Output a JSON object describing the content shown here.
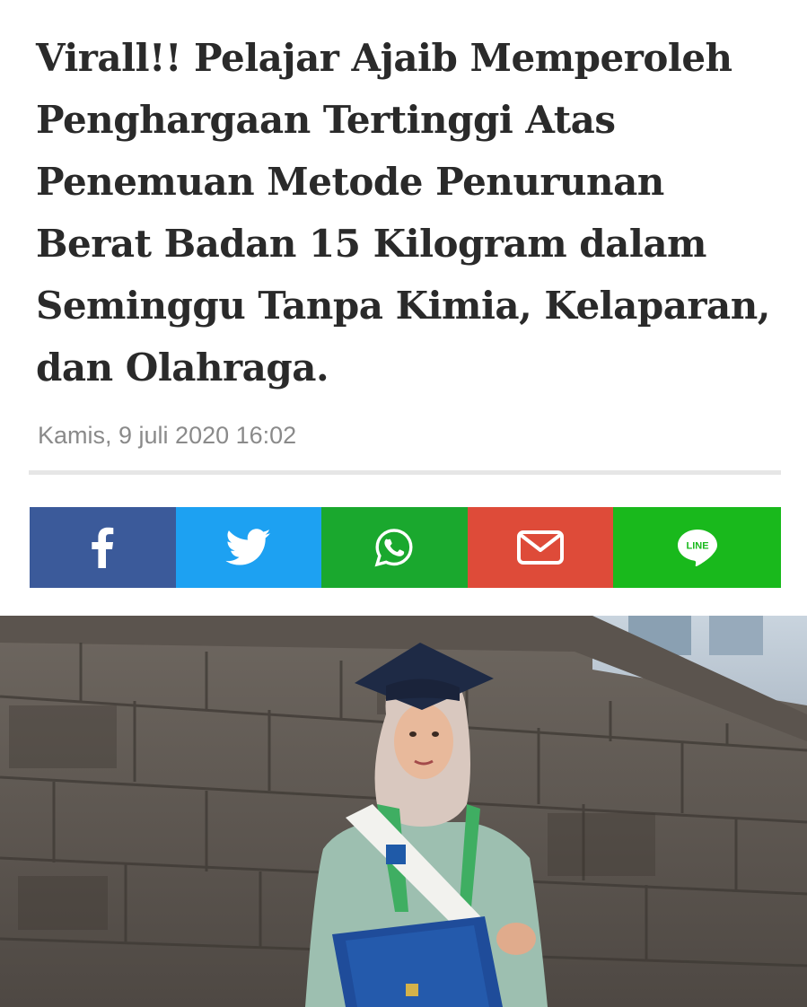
{
  "article": {
    "headline": "Virall!! Pelajar Ajaib Memperoleh Penghargaan Tertinggi Atas Penemuan Metode Penurunan Berat Badan 15 Kilogram dalam Seminggu Tanpa Kimia, Kelaparan, dan Olahraga.",
    "date": "Kamis, 9 juli 2020 16:02"
  },
  "share": {
    "buttons": [
      {
        "name": "facebook",
        "icon": "facebook-icon",
        "color": "#3b5a9a"
      },
      {
        "name": "twitter",
        "icon": "twitter-icon",
        "color": "#1da1f2"
      },
      {
        "name": "whatsapp",
        "icon": "whatsapp-icon",
        "color": "#1aa82e"
      },
      {
        "name": "email",
        "icon": "envelope-icon",
        "color": "#de4b39"
      },
      {
        "name": "line",
        "icon": "line-icon",
        "color": "#19b91c",
        "label": "LINE"
      }
    ]
  },
  "photo": {
    "description_icon": "graduation-photo"
  }
}
